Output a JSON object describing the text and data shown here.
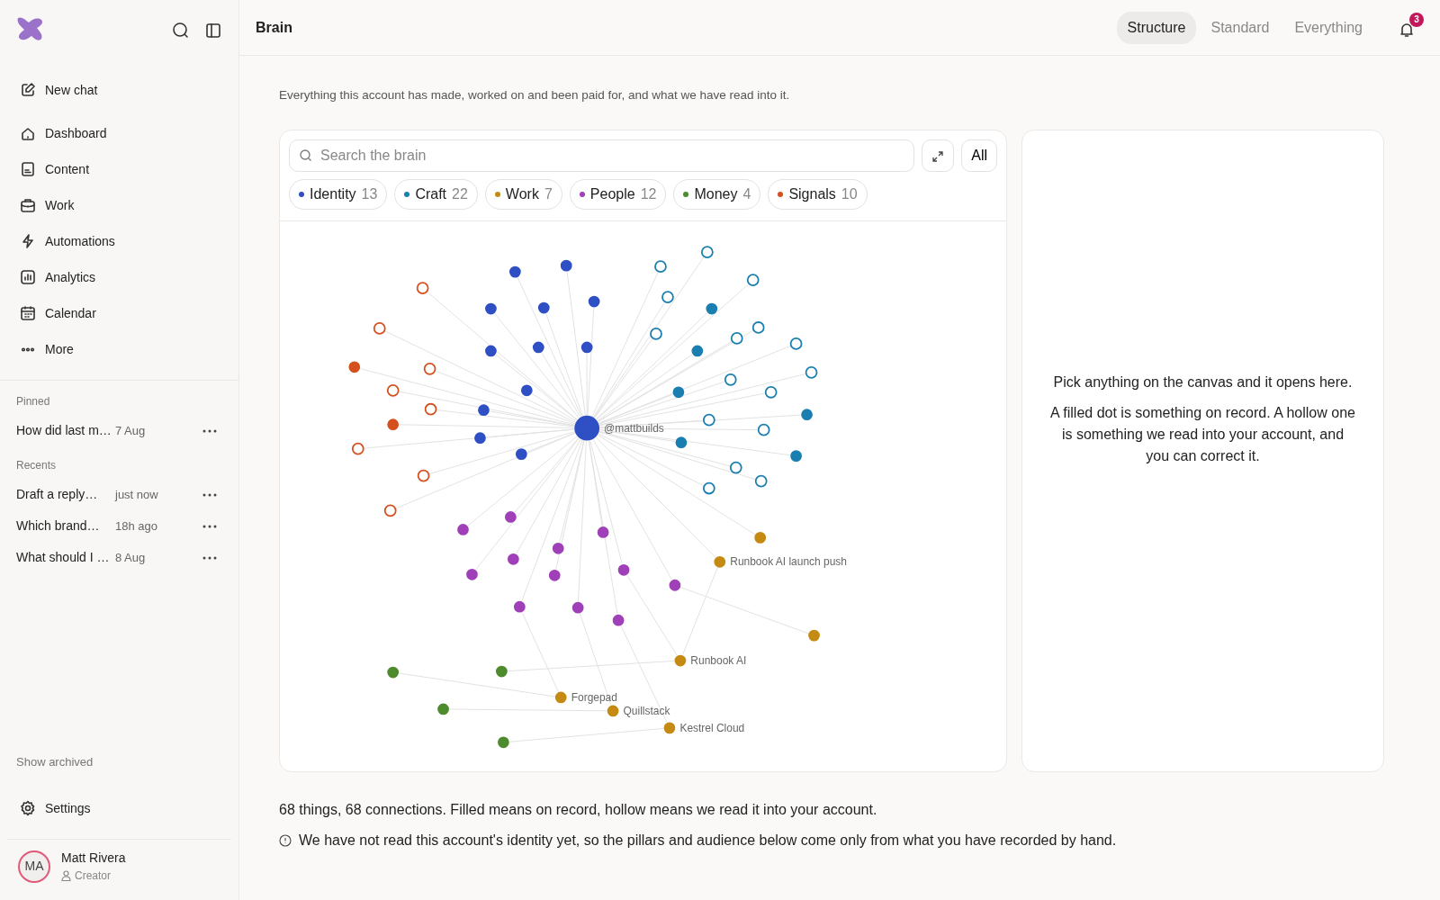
{
  "sidebar": {
    "new_chat": "New chat",
    "nav": [
      {
        "label": "Dashboard",
        "kind": "home"
      },
      {
        "label": "Content",
        "kind": "doc"
      },
      {
        "label": "Work",
        "kind": "briefcase"
      },
      {
        "label": "Automations",
        "kind": "bolt"
      },
      {
        "label": "Analytics",
        "kind": "chart"
      },
      {
        "label": "Calendar",
        "kind": "calendar"
      },
      {
        "label": "More",
        "kind": "dots"
      }
    ],
    "pinned": {
      "title": "Pinned",
      "items": [
        {
          "title": "How did last m…",
          "time": "7 Aug"
        }
      ]
    },
    "recents": {
      "title": "Recents",
      "items": [
        {
          "title": "Draft a reply…",
          "time": "just now"
        },
        {
          "title": "Which brand…",
          "time": "18h ago"
        },
        {
          "title": "What should I …",
          "time": "8 Aug"
        }
      ]
    },
    "show_archived": "Show archived",
    "settings": "Settings",
    "user": {
      "initials": "MA",
      "name": "Matt Rivera",
      "role": "Creator"
    }
  },
  "header": {
    "title": "Brain",
    "tabs": [
      {
        "label": "Structure",
        "selected": true
      },
      {
        "label": "Standard",
        "selected": false
      },
      {
        "label": "Everything",
        "selected": false
      }
    ],
    "notifications": "3"
  },
  "description": "Everything this account has made, worked on and been paid for, and what we have read into it.",
  "search": {
    "placeholder": "Search the brain"
  },
  "all_button": "All",
  "filters": [
    {
      "label": "Identity",
      "count": "13",
      "color": "#2f4fc4"
    },
    {
      "label": "Craft",
      "count": "22",
      "color": "#1a7fb0"
    },
    {
      "label": "Work",
      "count": "7",
      "color": "#c48a12"
    },
    {
      "label": "People",
      "count": "12",
      "color": "#a040b8"
    },
    {
      "label": "Money",
      "count": "4",
      "color": "#4e8a2e"
    },
    {
      "label": "Signals",
      "count": "10",
      "color": "#d4501e"
    }
  ],
  "graph_nodes": [
    {
      "color": "#2f4fc4",
      "filled": true,
      "label": "@mattbuilds"
    },
    {
      "color": "#2f4fc4",
      "filled": true
    },
    {
      "color": "#2f4fc4",
      "filled": true
    },
    {
      "color": "#2f4fc4",
      "filled": true
    },
    {
      "color": "#2f4fc4",
      "filled": true
    },
    {
      "color": "#2f4fc4",
      "filled": true
    },
    {
      "color": "#2f4fc4",
      "filled": true
    },
    {
      "color": "#2f4fc4",
      "filled": true
    },
    {
      "color": "#2f4fc4",
      "filled": true
    },
    {
      "color": "#2f4fc4",
      "filled": true
    },
    {
      "color": "#2f4fc4",
      "filled": true
    },
    {
      "color": "#2f4fc4",
      "filled": true
    },
    {
      "color": "#2f4fc4",
      "filled": true
    },
    {
      "color": "#1a7fb0",
      "filled": false
    },
    {
      "color": "#1a7fb0",
      "filled": false
    },
    {
      "color": "#1a7fb0",
      "filled": false
    },
    {
      "color": "#1a7fb0",
      "filled": false
    },
    {
      "color": "#1a7fb0",
      "filled": false
    },
    {
      "color": "#1a7fb0",
      "filled": false
    },
    {
      "color": "#1a7fb0",
      "filled": false
    },
    {
      "color": "#1a7fb0",
      "filled": false
    },
    {
      "color": "#1a7fb0",
      "filled": false
    },
    {
      "color": "#1a7fb0",
      "filled": false
    },
    {
      "color": "#1a7fb0",
      "filled": false
    },
    {
      "color": "#1a7fb0",
      "filled": false
    },
    {
      "color": "#1a7fb0",
      "filled": false
    },
    {
      "color": "#1a7fb0",
      "filled": false
    },
    {
      "color": "#1a7fb0",
      "filled": false
    },
    {
      "color": "#1a7fb0",
      "filled": false
    },
    {
      "color": "#1a7fb0",
      "filled": true
    },
    {
      "color": "#1a7fb0",
      "filled": true
    },
    {
      "color": "#1a7fb0",
      "filled": true
    },
    {
      "color": "#1a7fb0",
      "filled": true
    },
    {
      "color": "#1a7fb0",
      "filled": true
    },
    {
      "color": "#1a7fb0",
      "filled": true
    },
    {
      "color": "#d4501e",
      "filled": false
    },
    {
      "color": "#d4501e",
      "filled": false
    },
    {
      "color": "#d4501e",
      "filled": false
    },
    {
      "color": "#d4501e",
      "filled": false
    },
    {
      "color": "#d4501e",
      "filled": false
    },
    {
      "color": "#d4501e",
      "filled": false
    },
    {
      "color": "#d4501e",
      "filled": false
    },
    {
      "color": "#d4501e",
      "filled": false
    },
    {
      "color": "#d4501e",
      "filled": true
    },
    {
      "color": "#d4501e",
      "filled": true
    },
    {
      "color": "#a040b8",
      "filled": true
    },
    {
      "color": "#a040b8",
      "filled": true
    },
    {
      "color": "#a040b8",
      "filled": true
    },
    {
      "color": "#a040b8",
      "filled": true
    },
    {
      "color": "#a040b8",
      "filled": true
    },
    {
      "color": "#a040b8",
      "filled": true
    },
    {
      "color": "#a040b8",
      "filled": true
    },
    {
      "color": "#a040b8",
      "filled": true
    },
    {
      "color": "#a040b8",
      "filled": true
    },
    {
      "color": "#a040b8",
      "filled": true
    },
    {
      "color": "#a040b8",
      "filled": true
    },
    {
      "color": "#a040b8",
      "filled": true
    },
    {
      "color": "#c48a12",
      "filled": true
    },
    {
      "color": "#c48a12",
      "filled": true,
      "label": "Runbook AI launch push"
    },
    {
      "color": "#c48a12",
      "filled": true
    },
    {
      "color": "#c48a12",
      "filled": true,
      "label": "Runbook AI"
    },
    {
      "color": "#c48a12",
      "filled": true,
      "label": "Forgepad"
    },
    {
      "color": "#c48a12",
      "filled": true,
      "label": "Quillstack"
    },
    {
      "color": "#c48a12",
      "filled": true,
      "label": "Kestrel Cloud"
    },
    {
      "color": "#4e8a2e",
      "filled": true
    },
    {
      "color": "#4e8a2e",
      "filled": true
    },
    {
      "color": "#4e8a2e",
      "filled": true
    },
    {
      "color": "#4e8a2e",
      "filled": true
    }
  ],
  "detail_panel": [
    "Pick anything on the canvas and it opens here.",
    "A filled dot is something on record. A hollow one is something we read into your account, and you can correct it."
  ],
  "summary": "68 things, 68 connections. Filled means on record, hollow means we read it into your account.",
  "notice": "We have not read this account's identity yet, so the pillars and audience below come only from what you have recorded by hand."
}
